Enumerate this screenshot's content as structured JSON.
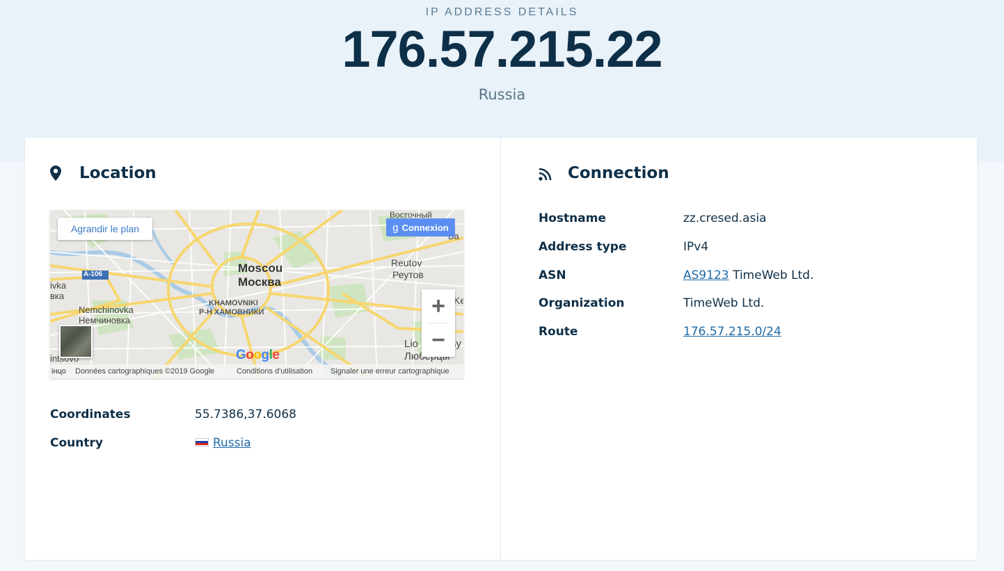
{
  "header": {
    "eyebrow": "IP ADDRESS DETAILS",
    "ip": "176.57.215.22",
    "country": "Russia"
  },
  "location": {
    "title": "Location",
    "icon": "map-pin-icon",
    "map": {
      "enlarge_label": "Agrandir le plan",
      "connect_label": "Connexion",
      "zoom_in": "+",
      "zoom_out": "−",
      "logo_text": "Google",
      "footer": {
        "data": "Données cartographiques ©2019 Google",
        "terms": "Conditions d'utilisation",
        "report": "Signaler une erreur cartographique"
      },
      "labels": {
        "moscow_fr": "Moscou",
        "moscow_ru": "Москва",
        "khamovniki_en": "KHAMOVNIKI",
        "khamovniki_ru": "Р-Н ХАМОВНИКИ",
        "nemchinovka_en": "Nemchinovka",
        "nemchinovka_ru": "Немчиновка",
        "reutov_en": "Reutov",
        "reutov_ru": "Реутов",
        "lyubertsy_en": "Lio",
        "lyubertsy_ru": "Люберцы",
        "vostochny_ru": "Восточный",
        "highway": "A-106",
        "west_edge_1": "ivka",
        "west_edge_2": "вка",
        "southwest_1": "intsovo",
        "southwest_2": "інцо",
        "east_edge_1": "Ke",
        "east_edge_2": "Ба",
        "east_edge_3": "sy"
      }
    },
    "fields": [
      {
        "key": "Coordinates",
        "value": "55.7386,37.6068"
      },
      {
        "key": "Country",
        "value": "Russia"
      }
    ]
  },
  "connection": {
    "title": "Connection",
    "icon": "rss-feed-icon",
    "fields": [
      {
        "key": "Hostname",
        "value": "zz.cresed.asia"
      },
      {
        "key": "Address type",
        "value": "IPv4"
      },
      {
        "key": "ASN",
        "link": "AS9123",
        "value": " TimeWeb Ltd."
      },
      {
        "key": "Organization",
        "value": "TimeWeb Ltd."
      },
      {
        "key": "Route",
        "link": "176.57.215.0/24"
      }
    ]
  },
  "colors": {
    "primary_text": "#0e2f48",
    "link": "#1f6aa6",
    "hero_bg": "#e9f2f9",
    "page_bg": "#f3f7fb"
  }
}
